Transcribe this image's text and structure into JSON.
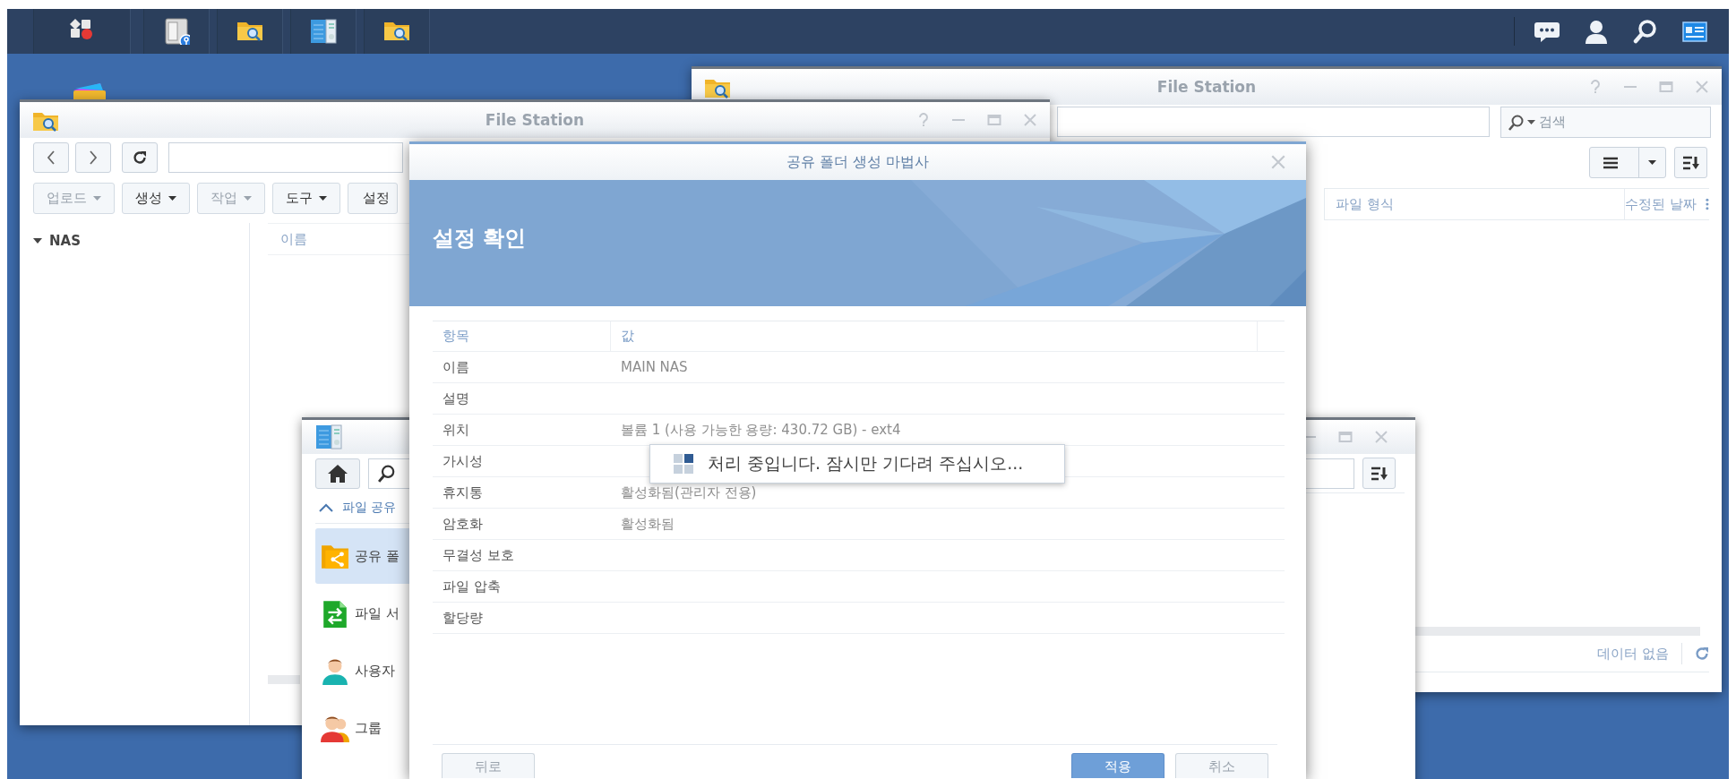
{
  "taskbar": {
    "apps": [
      {
        "kind": "menu"
      },
      {
        "kind": "security"
      },
      {
        "kind": "files"
      },
      {
        "kind": "panel"
      },
      {
        "kind": "files"
      }
    ],
    "tray": [
      {
        "kind": "chat"
      },
      {
        "kind": "user"
      },
      {
        "kind": "search"
      },
      {
        "kind": "widgets"
      }
    ]
  },
  "desktop": {
    "icons": [
      {
        "kind": "folders"
      }
    ]
  },
  "file_station_back": {
    "title": "File Station",
    "search": {
      "placeholder": "검색"
    },
    "columns": [
      "파일 형식",
      "수정된 날짜"
    ],
    "status": "데이터 없음"
  },
  "file_station_front": {
    "title": "File Station",
    "toolbar": [
      {
        "label": "업로드",
        "disabled": true
      },
      {
        "label": "생성",
        "disabled": false
      },
      {
        "label": "작업",
        "disabled": true
      },
      {
        "label": "도구",
        "disabled": false
      },
      {
        "label": "설정",
        "disabled": false
      }
    ],
    "tree": [
      {
        "label": "NAS",
        "expanded": true
      }
    ],
    "columns": [
      "이름"
    ]
  },
  "control_panel": {
    "section": {
      "label": "파일 공유",
      "expanded": true
    },
    "items": [
      {
        "label": "공유 폴",
        "kind": "share",
        "selected": true
      },
      {
        "label": "파일 서",
        "kind": "transfer",
        "selected": false
      },
      {
        "label": "사용자",
        "kind": "user",
        "selected": false
      },
      {
        "label": "그룹",
        "kind": "group",
        "selected": false
      }
    ]
  },
  "wizard": {
    "title": "공유 폴더 생성 마법사",
    "heading": "설정 확인",
    "columns": [
      "항목",
      "값"
    ],
    "rows": [
      {
        "item": "이름",
        "value": "MAIN NAS"
      },
      {
        "item": "설명"
      },
      {
        "item": "위치",
        "value": "볼륨 1 (사용 가능한 용량: 430.72 GB) - ext4"
      },
      {
        "item": "가시성"
      },
      {
        "item": "휴지통",
        "value": "활성화됨(관리자 전용)"
      },
      {
        "item": "암호화",
        "value": "활성화됨"
      },
      {
        "item": "무결성 보호"
      },
      {
        "item": "파일 압축"
      },
      {
        "item": "할당량"
      }
    ],
    "buttons": [
      {
        "label": "뒤로",
        "kind": "secondary"
      },
      {
        "label": "적용",
        "kind": "primary"
      },
      {
        "label": "취소",
        "kind": "secondary"
      }
    ]
  },
  "progress": {
    "message": "처리 중입니다. 잠시만 기다려 주십시오..."
  }
}
